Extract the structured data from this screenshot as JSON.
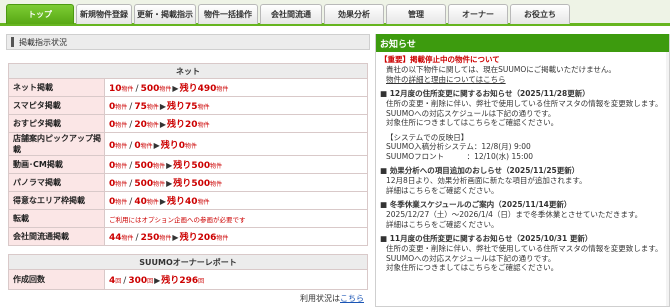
{
  "nav": {
    "tabs": [
      "トップ",
      "新規物件登録",
      "更新・掲載指示",
      "物件一括操作",
      "会社間流通",
      "効果分析",
      "管理",
      "オーナー",
      "お役立ち"
    ]
  },
  "listing": {
    "section_title": "掲載指示状況",
    "group_header": "ネット",
    "rows": [
      {
        "label": "ネット掲載",
        "a": "10",
        "a_unit": "物件",
        "b": "500",
        "b_unit": "物件",
        "rem_prefix": "残り",
        "rem": "490",
        "rem_unit": "物件"
      },
      {
        "label": "スマピタ掲載",
        "a": "0",
        "a_unit": "物件",
        "b": "75",
        "b_unit": "物件",
        "rem_prefix": "残り",
        "rem": "75",
        "rem_unit": "物件"
      },
      {
        "label": "おすピタ掲載",
        "a": "0",
        "a_unit": "物件",
        "b": "20",
        "b_unit": "物件",
        "rem_prefix": "残り",
        "rem": "20",
        "rem_unit": "物件"
      },
      {
        "label": "店舗案内ピックアップ掲載",
        "a": "0",
        "a_unit": "物件",
        "b": "0",
        "b_unit": "物件",
        "rem_prefix": "残り",
        "rem": "0",
        "rem_unit": "物件"
      },
      {
        "label": "動画･CM掲載",
        "a": "0",
        "a_unit": "物件",
        "b": "500",
        "b_unit": "物件",
        "rem_prefix": "残り",
        "rem": "500",
        "rem_unit": "物件"
      },
      {
        "label": "パノラマ掲載",
        "a": "0",
        "a_unit": "物件",
        "b": "500",
        "b_unit": "物件",
        "rem_prefix": "残り",
        "rem": "500",
        "rem_unit": "物件"
      },
      {
        "label": "得意なエリア枠掲載",
        "a": "0",
        "a_unit": "物件",
        "b": "40",
        "b_unit": "物件",
        "rem_prefix": "残り",
        "rem": "40",
        "rem_unit": "物件"
      }
    ],
    "tenki": {
      "label": "転載",
      "note": "ご利用にはオプション企画への参画が必要です"
    },
    "company_row": {
      "label": "会社間流通掲載",
      "a": "44",
      "a_unit": "物件",
      "b": "250",
      "b_unit": "物件",
      "rem_prefix": "残り",
      "rem": "206",
      "rem_unit": "物件"
    }
  },
  "owner_report": {
    "header": "SUUMOオーナーレポート",
    "label": "作成回数",
    "a": "4",
    "a_unit": "回",
    "b": "300",
    "b_unit": "回",
    "rem_prefix": "残り",
    "rem": "296",
    "rem_unit": "回",
    "usage_text": "利用状況は",
    "usage_link": "こちら"
  },
  "news": {
    "header": "お知らせ",
    "items": [
      {
        "type": "alert",
        "text": "【重要】掲載停止中の物件について"
      },
      {
        "type": "line",
        "text": "貴社の以下物件に関しては、現在SUUMOにご掲載いただけません。"
      },
      {
        "type": "link",
        "text": "物件の詳細と理由についてはこちら"
      },
      {
        "type": "gap"
      },
      {
        "type": "title",
        "text": "■ 12月度の住所変更に関するお知らせ（2025/11/28更新）"
      },
      {
        "type": "line",
        "text": "住所の変更・削除に伴い、弊社で使用している住所マスタの情報を変更致します。"
      },
      {
        "type": "line",
        "text": "SUUMOへの対応スケジュールは下記の通りです。"
      },
      {
        "type": "line",
        "text": "対象住所につきましてはこちらをご確認ください。"
      },
      {
        "type": "gap"
      },
      {
        "type": "line",
        "text": "【システムでの反映日】"
      },
      {
        "type": "line",
        "text": "SUUMO入稿分析システム：12/8(月) 9:00"
      },
      {
        "type": "line",
        "text": "SUUMOフロント　　　：12/10(水) 15:00"
      },
      {
        "type": "gap"
      },
      {
        "type": "title",
        "text": "■ 効果分析への項目追加のおしらせ（2025/11/25更新）"
      },
      {
        "type": "line",
        "text": "12月8日より、効果分析画面に新たな項目が追加されます。"
      },
      {
        "type": "line",
        "text": "詳細はこちらをご確認ください。"
      },
      {
        "type": "gap"
      },
      {
        "type": "title",
        "text": "■ 冬季休業スケジュールのご案内（2025/11/14更新）"
      },
      {
        "type": "line",
        "text": "2025/12/27（土）～2026/1/4（日）まで冬季休業とさせていただきます。"
      },
      {
        "type": "line",
        "text": "詳細はこちらをご確認ください。"
      },
      {
        "type": "gap"
      },
      {
        "type": "title",
        "text": "■ 11月度の住所変更に関するお知らせ（2025/10/31 更新）"
      },
      {
        "type": "line",
        "text": "住所の変更・削除に伴い、弊社で使用している住所マスタの情報を変更致します。"
      },
      {
        "type": "line",
        "text": "SUUMOへの対応スケジュールは下記の通りです。"
      },
      {
        "type": "line",
        "text": "対象住所につきましてはこちらをご確認ください。"
      }
    ]
  },
  "colors": {
    "accent_green": "#58a814",
    "news_header": "#3d9b0e",
    "label_pink": "#fbe6e6",
    "value_red": "#cc0000",
    "link_blue": "#1a55b5"
  }
}
